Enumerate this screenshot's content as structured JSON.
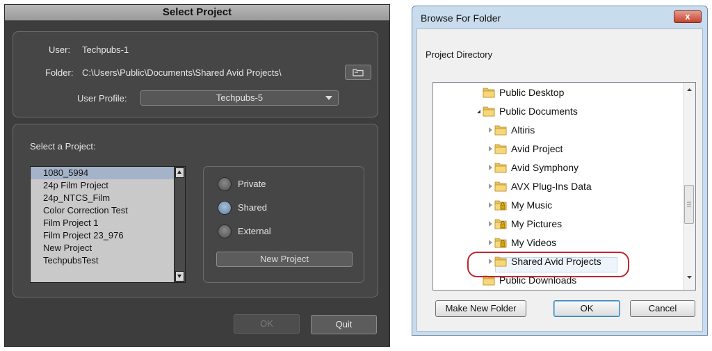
{
  "avid": {
    "title": "Select Project",
    "user_label": "User:",
    "user_value": "Techpubs-1",
    "folder_label": "Folder:",
    "folder_value": "C:\\Users\\Public\\Documents\\Shared Avid Projects\\",
    "profile_label": "User Profile:",
    "profile_value": "Techpubs-5",
    "select_label": "Select a Project:",
    "projects": [
      "1080_5994",
      "24p Film Project",
      "24p_NTCS_Film",
      "Color Correction Test",
      "Film Project 1",
      "Film Project 23_976",
      "New Project",
      "TechpubsTest"
    ],
    "selected_project": "1080_5994",
    "radios": [
      {
        "label": "Private",
        "checked": false
      },
      {
        "label": "Shared",
        "checked": true
      },
      {
        "label": "External",
        "checked": false
      }
    ],
    "new_project_label": "New Project",
    "ok_label": "OK",
    "quit_label": "Quit"
  },
  "browse": {
    "title": "Browse For Folder",
    "close_label": "x",
    "instruction": "Project Directory",
    "tree": [
      {
        "label": "Public Desktop",
        "level": 1,
        "expander": "none",
        "locked": false
      },
      {
        "label": "Public Documents",
        "level": 1,
        "expander": "open",
        "locked": false
      },
      {
        "label": "Altiris",
        "level": 2,
        "expander": "closed",
        "locked": false
      },
      {
        "label": "Avid Project",
        "level": 2,
        "expander": "closed",
        "locked": false
      },
      {
        "label": "Avid Symphony",
        "level": 2,
        "expander": "closed",
        "locked": false
      },
      {
        "label": "AVX Plug-Ins Data",
        "level": 2,
        "expander": "closed",
        "locked": false
      },
      {
        "label": "My Music",
        "level": 2,
        "expander": "closed",
        "locked": true
      },
      {
        "label": "My Pictures",
        "level": 2,
        "expander": "closed",
        "locked": true
      },
      {
        "label": "My Videos",
        "level": 2,
        "expander": "closed",
        "locked": true
      },
      {
        "label": "Shared Avid Projects",
        "level": 2,
        "expander": "closed",
        "locked": false
      },
      {
        "label": "Public Downloads",
        "level": 1,
        "expander": "none",
        "locked": false
      }
    ],
    "selected": "Shared Avid Projects",
    "make_new_folder_label": "Make New Folder",
    "ok_label": "OK",
    "cancel_label": "Cancel"
  },
  "colors": {
    "annotation_ring": "#c0262d",
    "avid_background": "#3d3d3d",
    "list_selection": "#a4b3c8"
  }
}
